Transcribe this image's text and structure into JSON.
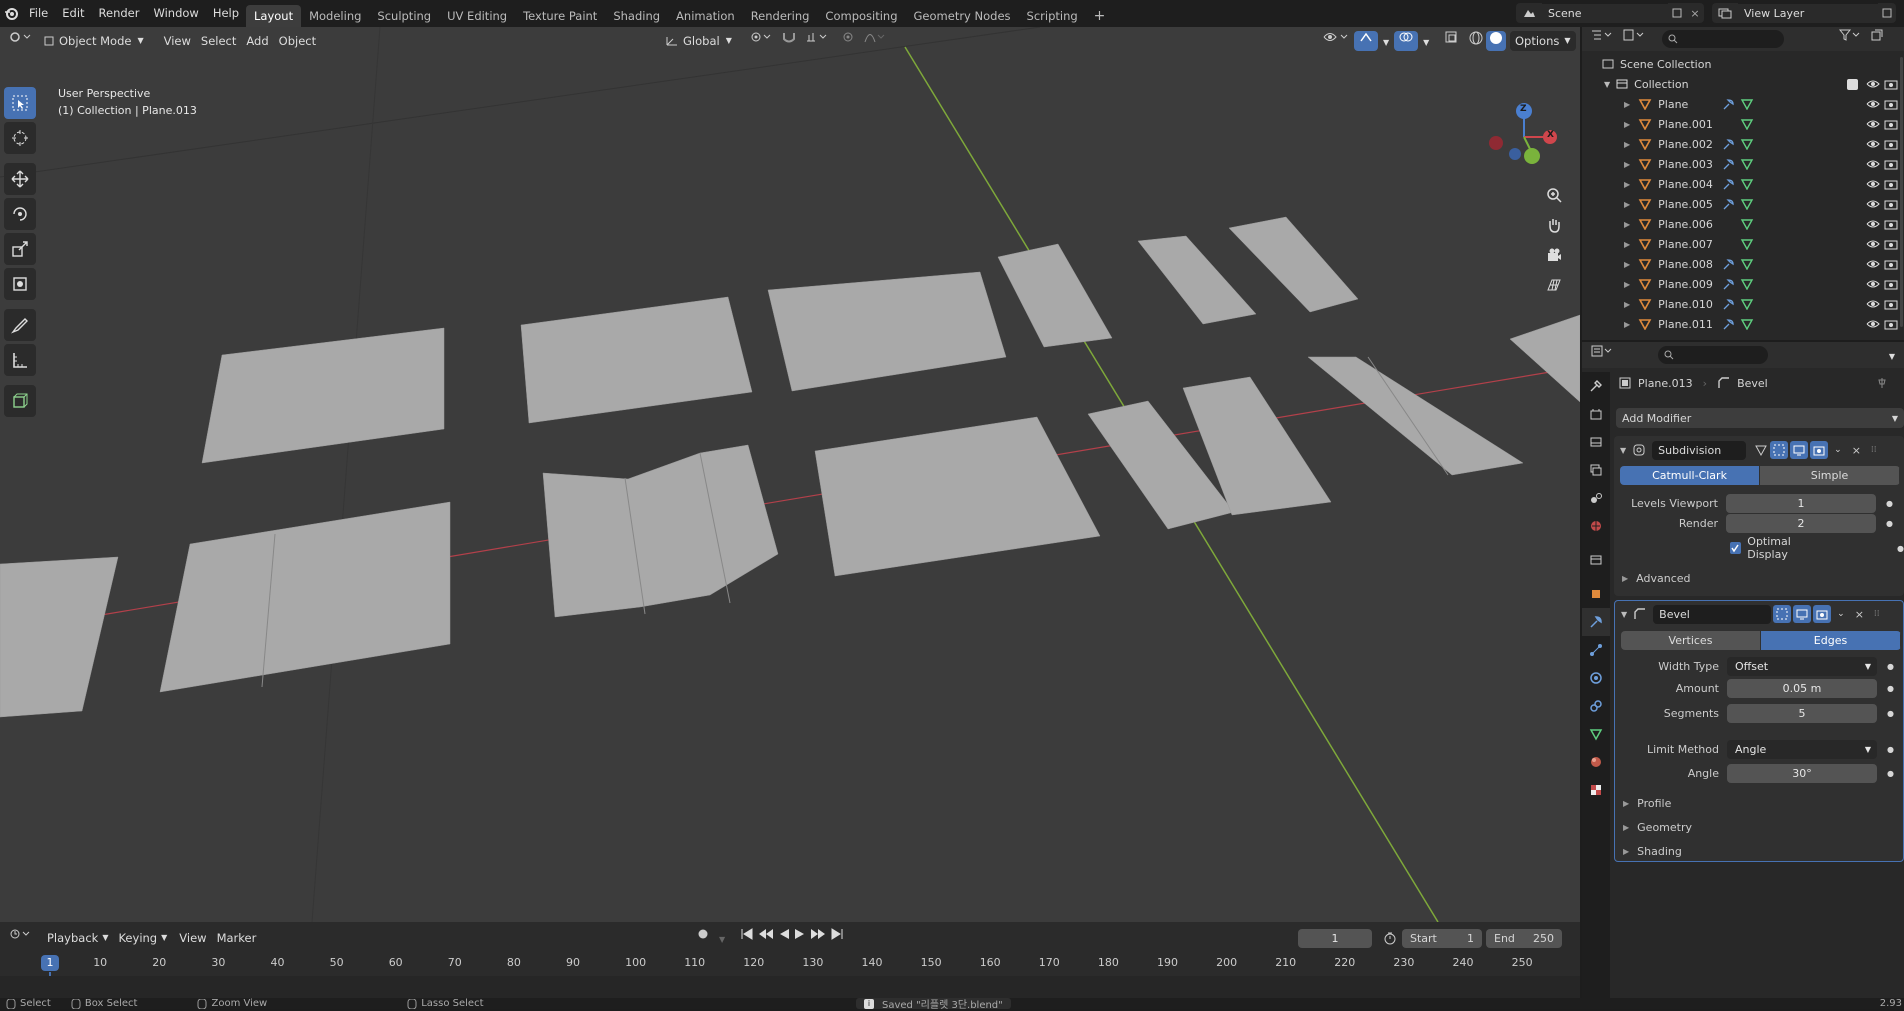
{
  "topbar": {
    "menu": [
      "File",
      "Edit",
      "Render",
      "Window",
      "Help"
    ],
    "workspaces": [
      "Layout",
      "Modeling",
      "Sculpting",
      "UV Editing",
      "Texture Paint",
      "Shading",
      "Animation",
      "Rendering",
      "Compositing",
      "Geometry Nodes",
      "Scripting"
    ],
    "active_workspace": "Layout",
    "scene": "Scene",
    "view_layer": "View Layer"
  },
  "viewport": {
    "mode": "Object Mode",
    "menus": [
      "View",
      "Select",
      "Add",
      "Object"
    ],
    "orientation": "Global",
    "options": "Options",
    "perspective": "User Perspective",
    "collection_info": "(1) Collection | Plane.013",
    "gizmo": {
      "z": "Z",
      "x": "X"
    }
  },
  "outliner": {
    "scene_collection": "Scene Collection",
    "collection": "Collection",
    "items": [
      {
        "name": "Plane",
        "modifier": true
      },
      {
        "name": "Plane.001",
        "modifier": false
      },
      {
        "name": "Plane.002",
        "modifier": true
      },
      {
        "name": "Plane.003",
        "modifier": true
      },
      {
        "name": "Plane.004",
        "modifier": true
      },
      {
        "name": "Plane.005",
        "modifier": true
      },
      {
        "name": "Plane.006",
        "modifier": false
      },
      {
        "name": "Plane.007",
        "modifier": false
      },
      {
        "name": "Plane.008",
        "modifier": true
      },
      {
        "name": "Plane.009",
        "modifier": true
      },
      {
        "name": "Plane.010",
        "modifier": true
      },
      {
        "name": "Plane.011",
        "modifier": true
      }
    ]
  },
  "properties": {
    "object": "Plane.013",
    "modifier_crumb": "Bevel",
    "add_modifier": "Add Modifier",
    "subdivision": {
      "name": "Subdivision",
      "mode_a": "Catmull-Clark",
      "mode_b": "Simple",
      "levels_label": "Levels Viewport",
      "levels_value": "1",
      "render_label": "Render",
      "render_value": "2",
      "optimal_label": "Optimal Display",
      "advanced": "Advanced"
    },
    "bevel": {
      "name": "Bevel",
      "mode_a": "Vertices",
      "mode_b": "Edges",
      "width_type_label": "Width Type",
      "width_type_value": "Offset",
      "amount_label": "Amount",
      "amount_value": "0.05 m",
      "segments_label": "Segments",
      "segments_value": "5",
      "limit_label": "Limit Method",
      "limit_value": "Angle",
      "angle_label": "Angle",
      "angle_value": "30°",
      "profile": "Profile",
      "geometry": "Geometry",
      "shading": "Shading"
    }
  },
  "timeline": {
    "menus": [
      "Playback",
      "Keying",
      "View",
      "Marker"
    ],
    "current_frame": "1",
    "start_label": "Start",
    "start_value": "1",
    "end_label": "End",
    "end_value": "250",
    "ticks": [
      "1",
      "10",
      "20",
      "30",
      "40",
      "50",
      "60",
      "70",
      "80",
      "90",
      "100",
      "110",
      "120",
      "130",
      "140",
      "150",
      "160",
      "170",
      "180",
      "190",
      "200",
      "210",
      "220",
      "230",
      "240",
      "250"
    ]
  },
  "statusbar": {
    "select": "Select",
    "box_select": "Box Select",
    "zoom": "Zoom View",
    "lasso": "Lasso Select",
    "message": "Saved \"리플렛 3단.blend\"",
    "version": "2.93"
  },
  "colors": {
    "accent": "#4772b3",
    "object_orange": "#e08a3c",
    "mesh_green": "#5fcf80",
    "modifier_blue": "#6e9fdc",
    "x_axis": "#b3404a",
    "y_axis": "#7ea83a"
  }
}
